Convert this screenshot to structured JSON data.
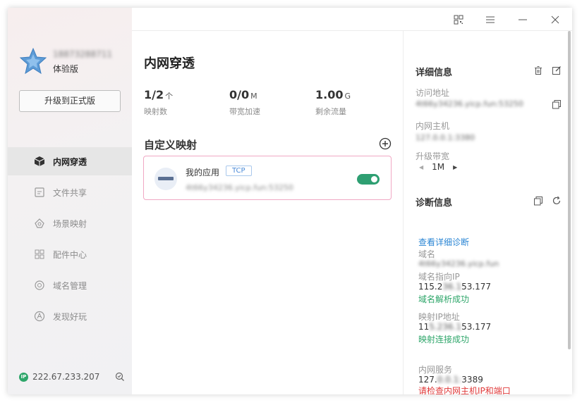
{
  "user": {
    "name": "18873288711",
    "level": "体验版",
    "upgrade_label": "升级到正式版"
  },
  "nav": [
    {
      "label": "内网穿透",
      "icon": "cube-icon",
      "active": true
    },
    {
      "label": "文件共享",
      "icon": "file-share-icon",
      "active": false
    },
    {
      "label": "场景映射",
      "icon": "scene-map-icon",
      "active": false
    },
    {
      "label": "配件中心",
      "icon": "apps-grid-icon",
      "active": false
    },
    {
      "label": "域名管理",
      "icon": "domain-icon",
      "active": false
    },
    {
      "label": "发现好玩",
      "icon": "discover-icon",
      "active": false
    }
  ],
  "footer": {
    "ip_badge": "IP",
    "ip": "222.67.233.207"
  },
  "main": {
    "title": "内网穿透",
    "stats": [
      {
        "value": "1/2",
        "unit": "个",
        "label": "映射数"
      },
      {
        "value": "0/0",
        "unit": "M",
        "label": "带宽加速"
      },
      {
        "value": "1.00",
        "unit": "G",
        "label": "剩余流量"
      }
    ],
    "section_title": "自定义映射",
    "mapping": {
      "name": "我的应用",
      "protocol": "TCP",
      "domain": "4t66y34236.yicp.fun:53250",
      "enabled": true
    }
  },
  "details": {
    "title": "详细信息",
    "access_label": "访问地址",
    "access_value": "4t66y34236.yicp.fun:53250",
    "host_label": "内网主机",
    "host_value": "127.0.0.1:3380",
    "bandwidth_label": "升级带宽",
    "bandwidth_value": "1M"
  },
  "diagnosis": {
    "title": "诊断信息",
    "view_detail": "查看详细诊断",
    "domain_label": "域名",
    "domain_value": "4t66y34236.yicp.fun",
    "dns_label": "域名指向IP",
    "dns_value_a": "115.2",
    "dns_value_mask": "36.1",
    "dns_value_b": "53.177",
    "dns_status": "域名解析成功",
    "map_ip_label": "映射IP地址",
    "map_ip_a": "11",
    "map_ip_mask": "5.236.1",
    "map_ip_b": "53.177",
    "map_status": "映射连接成功",
    "service_label": "内网服务",
    "service_a": "127.",
    "service_mask": "0.0.1:",
    "service_b": "3389",
    "service_error": "请检查内网主机IP和端口"
  },
  "colors": {
    "accent_green": "#2e9f72",
    "link_blue": "#2b86d4",
    "error_red": "#e03a3a",
    "card_border": "#f0a8c4"
  }
}
